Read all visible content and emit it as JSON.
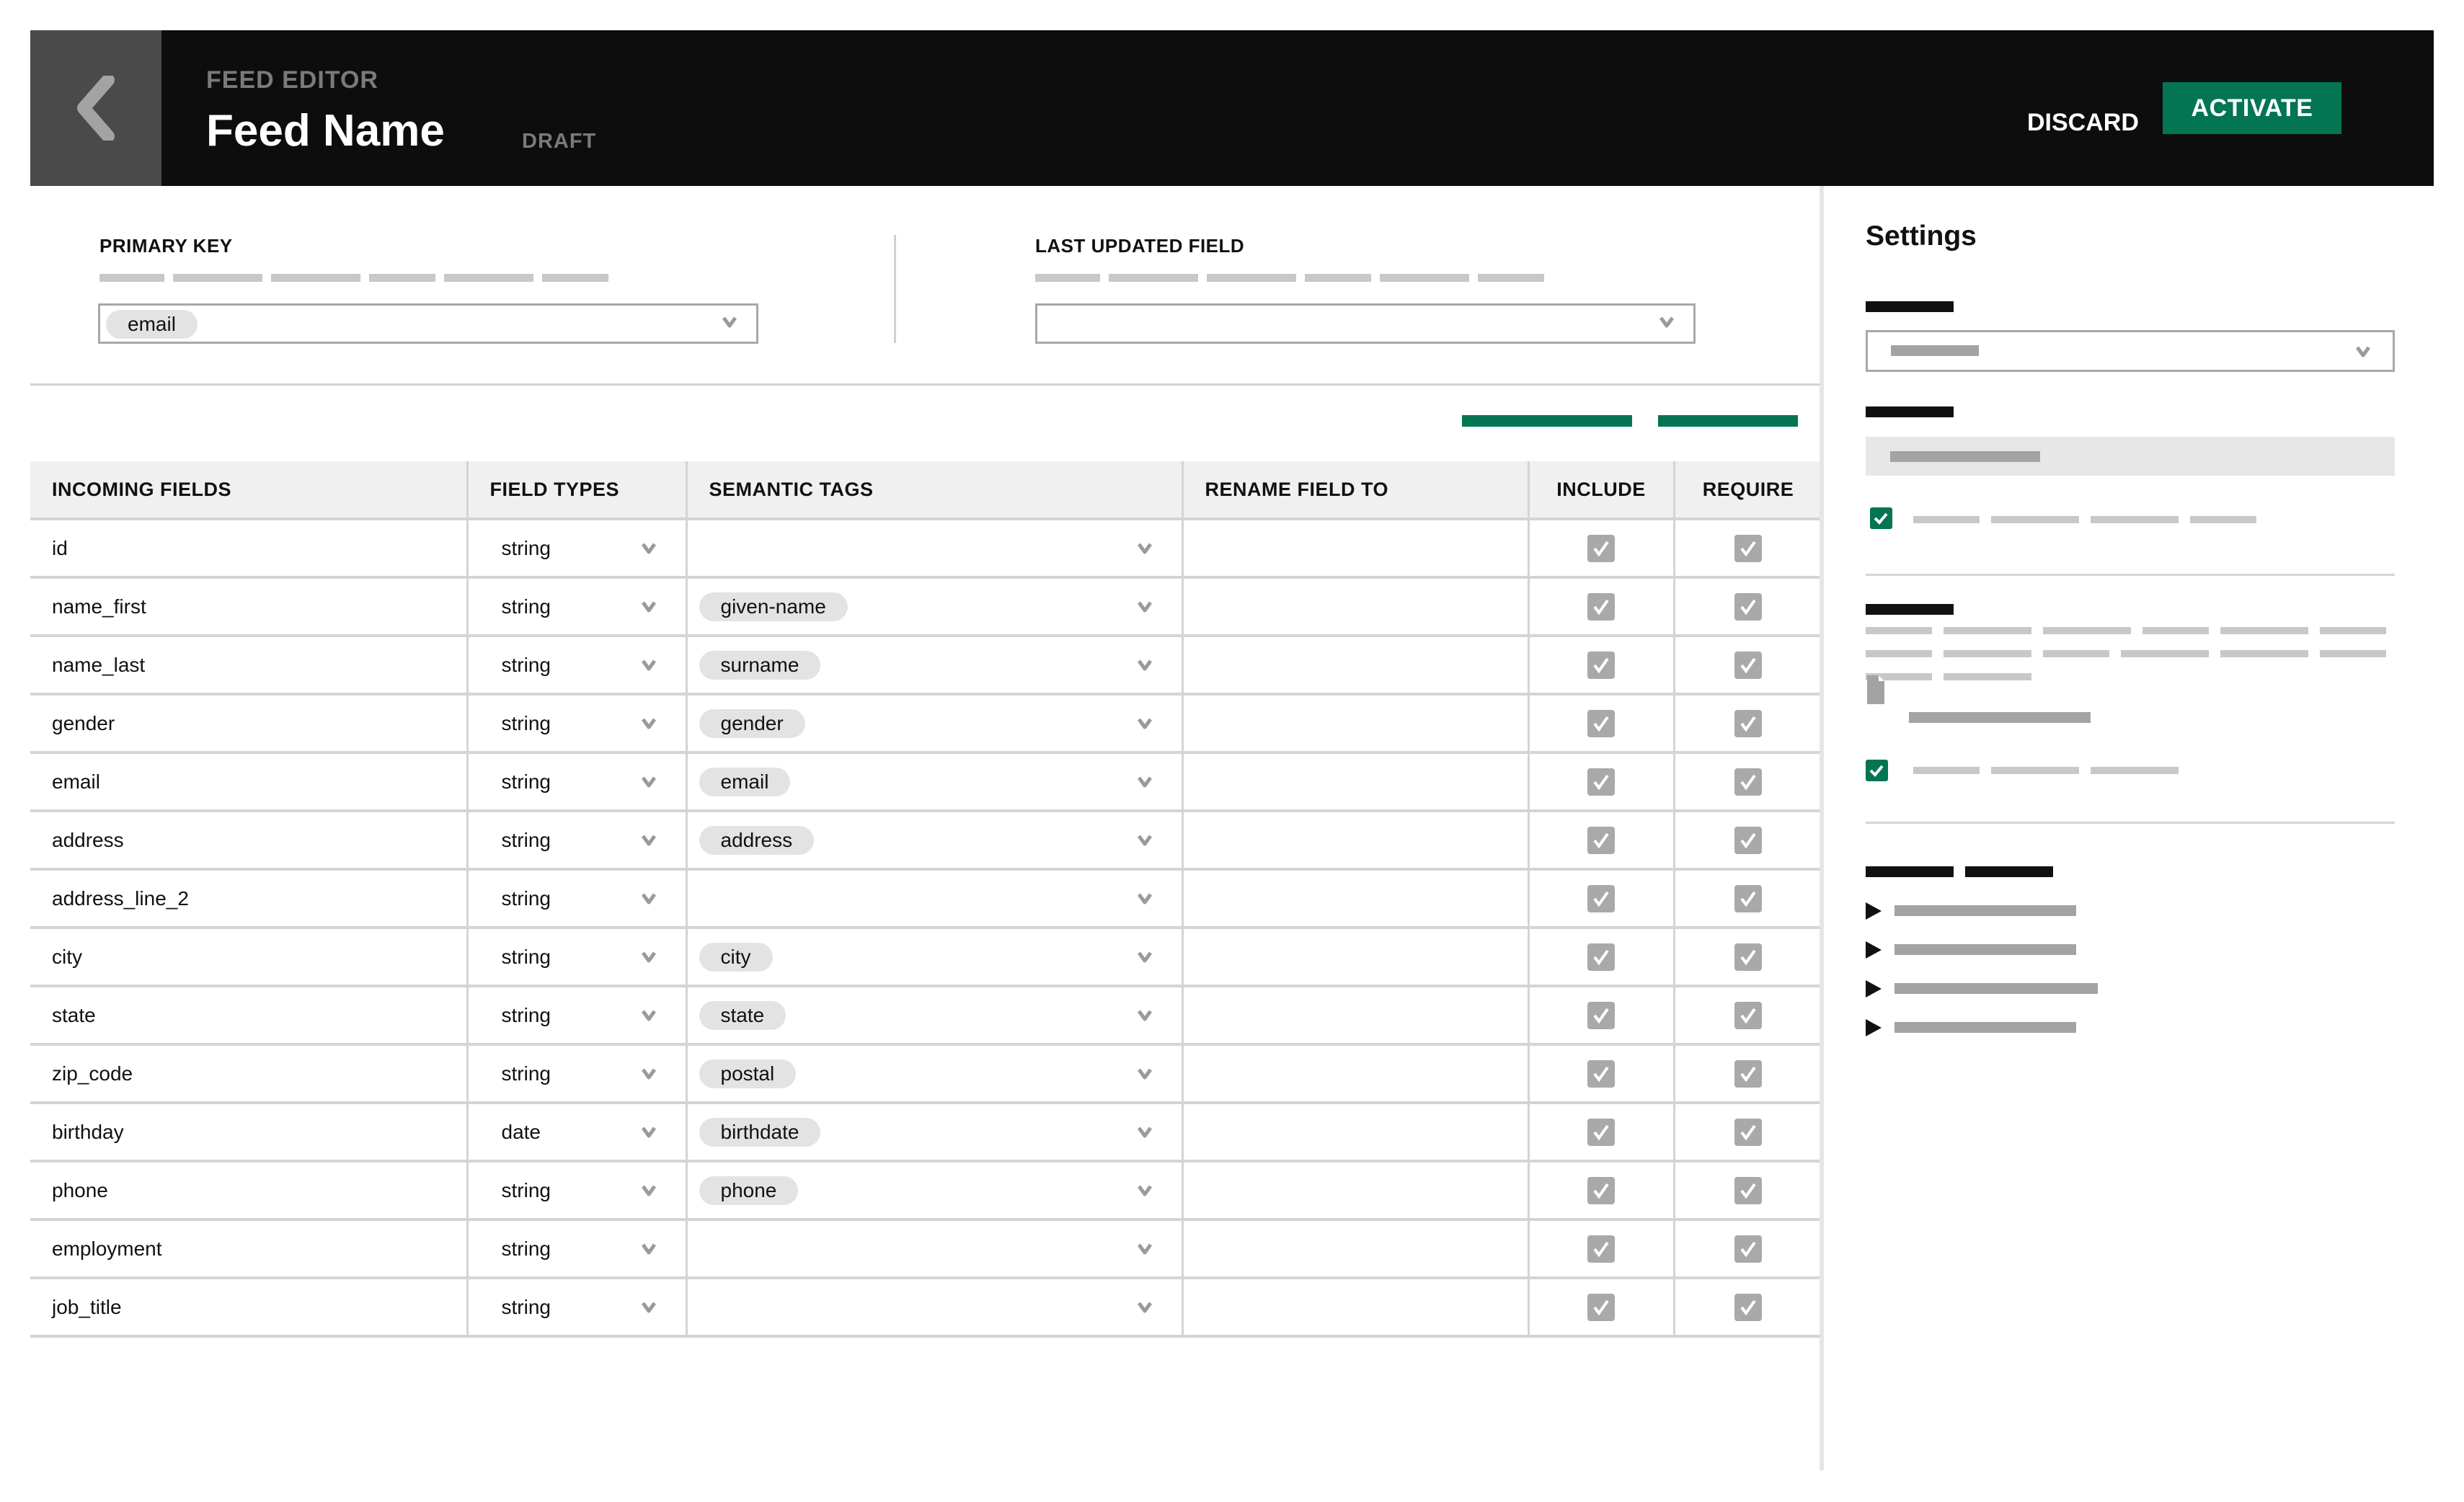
{
  "header": {
    "eyebrow": "FEED EDITOR",
    "title": "Feed Name",
    "status": "DRAFT",
    "discard_label": "DISCARD",
    "activate_label": "ACTIVATE",
    "back_icon": "chevron-left-icon"
  },
  "config": {
    "primary_key": {
      "label": "PRIMARY KEY",
      "value": "email"
    },
    "last_updated_field": {
      "label": "LAST UPDATED FIELD",
      "value": ""
    }
  },
  "colors": {
    "accent": "#037552",
    "header_bg": "#0d0d0d",
    "back_bg": "#4a4a4a"
  },
  "table": {
    "columns": [
      "INCOMING FIELDS",
      "FIELD TYPES",
      "SEMANTIC TAGS",
      "RENAME FIELD TO",
      "INCLUDE",
      "REQUIRE"
    ],
    "rows": [
      {
        "field": "id",
        "type": "string",
        "tag": "",
        "rename": "",
        "include": true,
        "require": true
      },
      {
        "field": "name_first",
        "type": "string",
        "tag": "given-name",
        "rename": "",
        "include": true,
        "require": true
      },
      {
        "field": "name_last",
        "type": "string",
        "tag": "surname",
        "rename": "",
        "include": true,
        "require": true
      },
      {
        "field": "gender",
        "type": "string",
        "tag": "gender",
        "rename": "",
        "include": true,
        "require": true
      },
      {
        "field": "email",
        "type": "string",
        "tag": "email",
        "rename": "",
        "include": true,
        "require": true
      },
      {
        "field": "address",
        "type": "string",
        "tag": "address",
        "rename": "",
        "include": true,
        "require": true
      },
      {
        "field": "address_line_2",
        "type": "string",
        "tag": "",
        "rename": "",
        "include": true,
        "require": true
      },
      {
        "field": "city",
        "type": "string",
        "tag": "city",
        "rename": "",
        "include": true,
        "require": true
      },
      {
        "field": "state",
        "type": "string",
        "tag": "state",
        "rename": "",
        "include": true,
        "require": true
      },
      {
        "field": "zip_code",
        "type": "string",
        "tag": "postal",
        "rename": "",
        "include": true,
        "require": true
      },
      {
        "field": "birthday",
        "type": "date",
        "tag": "birthdate",
        "rename": "",
        "include": true,
        "require": true
      },
      {
        "field": "phone",
        "type": "string",
        "tag": "phone",
        "rename": "",
        "include": true,
        "require": true
      },
      {
        "field": "employment",
        "type": "string",
        "tag": "",
        "rename": "",
        "include": true,
        "require": true
      },
      {
        "field": "job_title",
        "type": "string",
        "tag": "",
        "rename": "",
        "include": true,
        "require": true
      }
    ]
  },
  "settings": {
    "title": "Settings",
    "checkbox_1_checked": true,
    "checkbox_2_checked": true,
    "collapsible_items_count": 4
  }
}
